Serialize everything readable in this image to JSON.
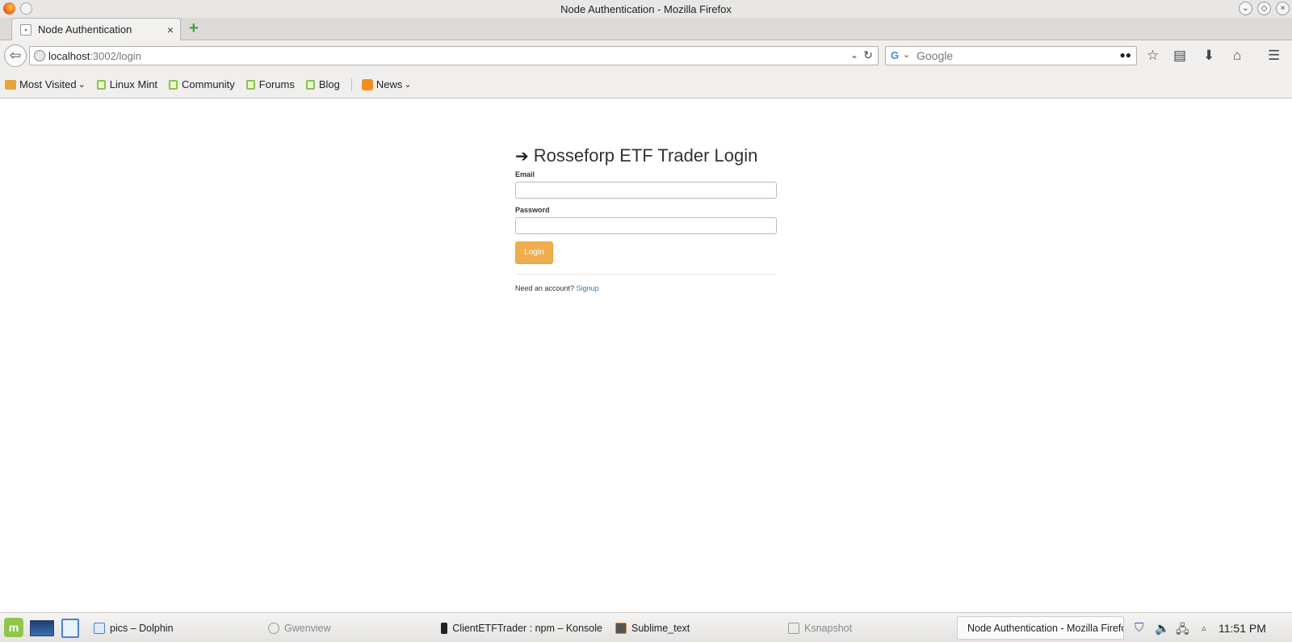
{
  "window": {
    "title": "Node Authentication - Mozilla Firefox"
  },
  "tab": {
    "title": "Node Authentication",
    "close": "×",
    "new_tab": "+"
  },
  "nav": {
    "back": "⇦",
    "url_host": "localhost",
    "url_path": ":3002/login",
    "url_dropdown": "⌄",
    "reload": "↻",
    "search_engine": "G",
    "search_dropdown": "⌄",
    "search_placeholder": "Google",
    "bookmark": "☆",
    "reading_list": "▤",
    "downloads": "⬇",
    "home": "⌂",
    "menu": "☰"
  },
  "bookmarks": {
    "most_visited": "Most Visited",
    "items": [
      "Linux Mint",
      "Community",
      "Forums",
      "Blog"
    ],
    "news": "News",
    "chevron": "⌄"
  },
  "login": {
    "icon": "➔",
    "title": "Rosseforp ETF Trader Login",
    "email_label": "Email",
    "email_value": "",
    "password_label": "Password",
    "password_value": "",
    "button": "Login",
    "signup_prompt": "Need an account?",
    "signup_link": "Signup"
  },
  "taskbar": {
    "start": "m",
    "tasks": [
      {
        "label": "pics – Dolphin",
        "dim": false
      },
      {
        "label": "Gwenview",
        "dim": true
      },
      {
        "label": "ClientETFTrader : npm – Konsole",
        "dim": false
      },
      {
        "label": "Sublime_text",
        "dim": false
      },
      {
        "label": "Ksnapshot",
        "dim": true
      },
      {
        "label": "Node Authentication - Mozilla Firefox",
        "dim": false
      }
    ],
    "clock": "11:51 PM"
  },
  "colors": {
    "accent_button": "#f0ad4e",
    "link": "#337ab7",
    "mint_green": "#8bc34a"
  }
}
